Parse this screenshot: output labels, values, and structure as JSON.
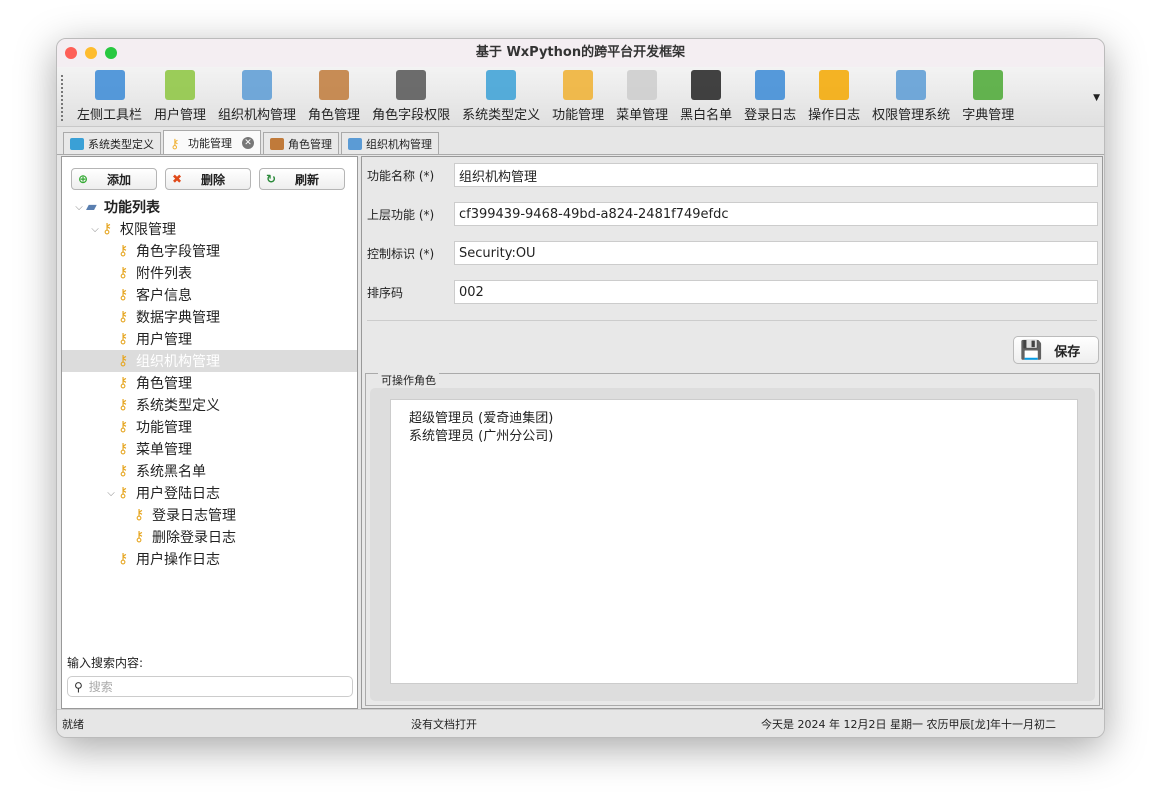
{
  "window": {
    "title": "基于 WxPython的跨平台开发框架"
  },
  "toolbar": [
    {
      "label": "左侧工具栏",
      "icon": "layout-icon",
      "color": "#3a8ad6"
    },
    {
      "label": "用户管理",
      "icon": "user-icon",
      "color": "#8cc63e"
    },
    {
      "label": "组织机构管理",
      "icon": "org-chart-icon",
      "color": "#5b9bd5"
    },
    {
      "label": "角色管理",
      "icon": "role-icon",
      "color": "#c07a3a"
    },
    {
      "label": "角色字段权限",
      "icon": "traffic-light-icon",
      "color": "#555555"
    },
    {
      "label": "系统类型定义",
      "icon": "monitor-icon",
      "color": "#3aa0d6"
    },
    {
      "label": "功能管理",
      "icon": "keys-icon",
      "color": "#f0b030"
    },
    {
      "label": "菜单管理",
      "icon": "menu-icon",
      "color": "#cccccc"
    },
    {
      "label": "黑白名单",
      "icon": "spy-icon",
      "color": "#222222"
    },
    {
      "label": "登录日志",
      "icon": "list-icon",
      "color": "#3a8ad6"
    },
    {
      "label": "操作日志",
      "icon": "warning-icon",
      "color": "#f5a800"
    },
    {
      "label": "权限管理系统",
      "icon": "computer-key-icon",
      "color": "#5b9bd5"
    },
    {
      "label": "字典管理",
      "icon": "book-icon",
      "color": "#4aa832"
    }
  ],
  "tabs": [
    {
      "label": "系统类型定义"
    },
    {
      "label": "功能管理"
    },
    {
      "label": "角色管理"
    },
    {
      "label": "组织机构管理"
    }
  ],
  "left": {
    "add": "添加",
    "delete": "删除",
    "refresh": "刷新",
    "tree": [
      {
        "label": "功能列表",
        "level": 0,
        "expanded": true
      },
      {
        "label": "权限管理",
        "level": 1,
        "expanded": true
      },
      {
        "label": "角色字段管理",
        "level": 2
      },
      {
        "label": "附件列表",
        "level": 2
      },
      {
        "label": "客户信息",
        "level": 2
      },
      {
        "label": "数据字典管理",
        "level": 2
      },
      {
        "label": "用户管理",
        "level": 2
      },
      {
        "label": "组织机构管理",
        "level": 2,
        "selected": true
      },
      {
        "label": "角色管理",
        "level": 2
      },
      {
        "label": "系统类型定义",
        "level": 2
      },
      {
        "label": "功能管理",
        "level": 2
      },
      {
        "label": "菜单管理",
        "level": 2
      },
      {
        "label": "系统黑名单",
        "level": 2
      },
      {
        "label": "用户登陆日志",
        "level": 2,
        "expanded": true
      },
      {
        "label": "登录日志管理",
        "level": 3
      },
      {
        "label": "删除登录日志",
        "level": 3
      },
      {
        "label": "用户操作日志",
        "level": 2
      }
    ],
    "search_label": "输入搜索内容:",
    "search_placeholder": "搜索"
  },
  "form": {
    "fields": [
      {
        "label": "功能名称 (*)",
        "value": "组织机构管理"
      },
      {
        "label": "上层功能 (*)",
        "value": "cf399439-9468-49bd-a824-2481f749efdc"
      },
      {
        "label": "控制标识 (*)",
        "value": "Security:OU"
      },
      {
        "label": "排序码",
        "value": "002"
      }
    ],
    "save": "保存",
    "roles_title": "可操作角色",
    "roles": [
      "超级管理员 (爱奇迪集团)",
      "系统管理员 (广州分公司)"
    ]
  },
  "status": {
    "left": "就绪",
    "middle": "没有文档打开",
    "right": "今天是 2024 年 12月2日 星期一 农历甲辰[龙]年十一月初二"
  }
}
